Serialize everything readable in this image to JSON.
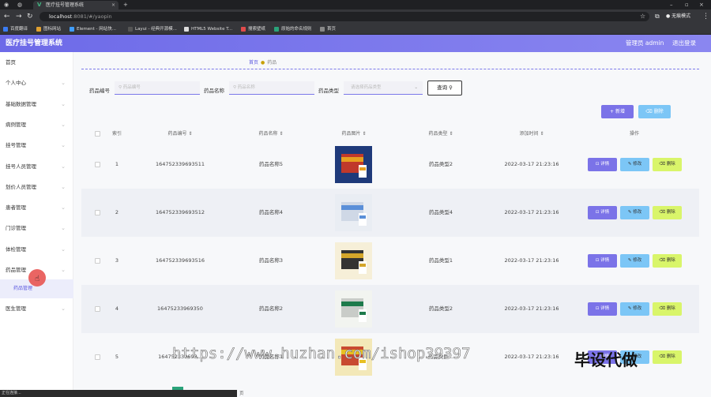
{
  "browser": {
    "tab_title": "医疗挂号管理系统",
    "url_host": "localhost",
    "url_path": ":8081/#/yaopin",
    "profile_label": "无痕模式",
    "bookmarks": [
      {
        "label": "百度翻译",
        "color": "#3b7cf3"
      },
      {
        "label": "图标网站",
        "color": "#e0a030"
      },
      {
        "label": "Element - 网站快...",
        "color": "#409eff"
      },
      {
        "label": "Layui - 经典开源模...",
        "color": "#555"
      },
      {
        "label": "HTML5 Website T...",
        "color": "#ddd"
      },
      {
        "label": "搜索壁纸",
        "color": "#e14b4b"
      },
      {
        "label": "原始的命名规则",
        "color": "#2aa37a"
      },
      {
        "label": "首页",
        "color": "#888"
      }
    ]
  },
  "header": {
    "title": "医疗挂号管理系统",
    "admin_label": "管理员 admin",
    "logout_label": "退出登录"
  },
  "sidebar": {
    "items": [
      "首页",
      "个人中心",
      "基础数据管理",
      "病例管理",
      "挂号管理",
      "挂号人员管理",
      "划价人员管理",
      "患者管理",
      "门诊管理",
      "体检管理",
      "药品管理"
    ],
    "sub_item": "药品管理",
    "last_item": "医生管理"
  },
  "breadcrumb": {
    "home": "首页",
    "current": "药品"
  },
  "search": {
    "code_label": "药品编号",
    "code_placeholder": "药品编号",
    "name_label": "药品名称",
    "name_placeholder": "药品名称",
    "type_label": "药品类型",
    "type_placeholder": "请选择药品类型",
    "button": "查询"
  },
  "toolbar": {
    "add": "新增",
    "delete": "删除"
  },
  "table": {
    "headers": {
      "index": "索引",
      "code": "药品编号",
      "name": "药品名称",
      "pic": "药品图片",
      "type": "药品类型",
      "time": "添加时间",
      "op": "操作"
    },
    "rows": [
      {
        "index": "1",
        "code": "164752339693511",
        "name": "药品名称5",
        "type": "药品类型2",
        "time": "2022-03-17 21:23:16"
      },
      {
        "index": "2",
        "code": "164752339693512",
        "name": "药品名称4",
        "type": "药品类型4",
        "time": "2022-03-17 21:23:16"
      },
      {
        "index": "3",
        "code": "164752339693516",
        "name": "药品名称3",
        "type": "药品类型1",
        "time": "2022-03-17 21:23:16"
      },
      {
        "index": "4",
        "code": "16475233969350",
        "name": "药品名称2",
        "type": "药品类型2",
        "time": "2022-03-17 21:23:16"
      },
      {
        "index": "5",
        "code": "164752339693...",
        "name": "药品名称1",
        "type": "药品类型...",
        "time": "2022-03-17 21:23:16"
      }
    ],
    "actions": {
      "detail": "详情",
      "edit": "修改",
      "delete": "删除"
    }
  },
  "overlay": {
    "watermark_url": "https://www.huzhan.com/ishop39397",
    "watermark_text": "毕设代做"
  },
  "status_bar": "正在连接...",
  "pager_text": "页"
}
